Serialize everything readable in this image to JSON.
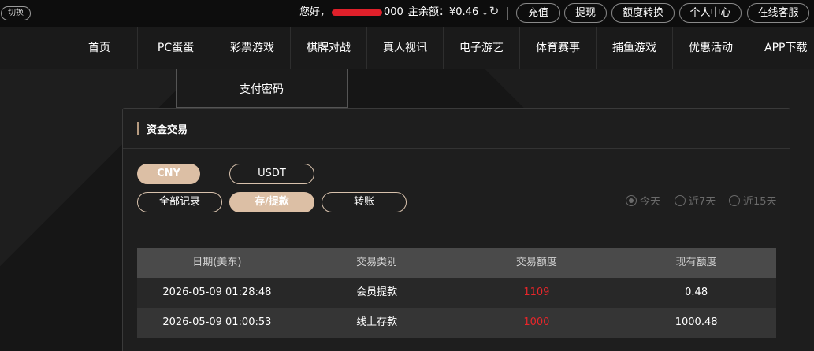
{
  "topbar": {
    "switch_label": "切换",
    "greeting_prefix": "您好，",
    "greeting_suffix": "000",
    "balance_label": "主余额：",
    "balance_value": "¥0.46",
    "buttons": [
      "充值",
      "提现",
      "额度转换",
      "个人中心",
      "在线客服"
    ]
  },
  "nav": {
    "items": [
      "首页",
      "PC蛋蛋",
      "彩票游戏",
      "棋牌对战",
      "真人视讯",
      "电子游艺",
      "体育赛事",
      "捕鱼游戏",
      "优惠活动",
      "APP下载"
    ]
  },
  "subnav": {
    "item": "支付密码"
  },
  "panel": {
    "title": "资金交易",
    "currency_tabs": [
      "CNY",
      "USDT"
    ],
    "record_tabs": [
      "全部记录",
      "存/提款",
      "转账"
    ],
    "date_filters": [
      "今天",
      "近7天",
      "近15天"
    ],
    "accent_color": "#dcbfa5",
    "amount_color": "#e8262a"
  },
  "table": {
    "headers": [
      "日期(美东)",
      "交易类别",
      "交易额度",
      "现有额度"
    ],
    "rows": [
      [
        "2026-05-09 01:28:48",
        "会员提款",
        "1109",
        "0.48"
      ],
      [
        "2026-05-09 01:00:53",
        "线上存款",
        "1000",
        "1000.48"
      ]
    ]
  }
}
